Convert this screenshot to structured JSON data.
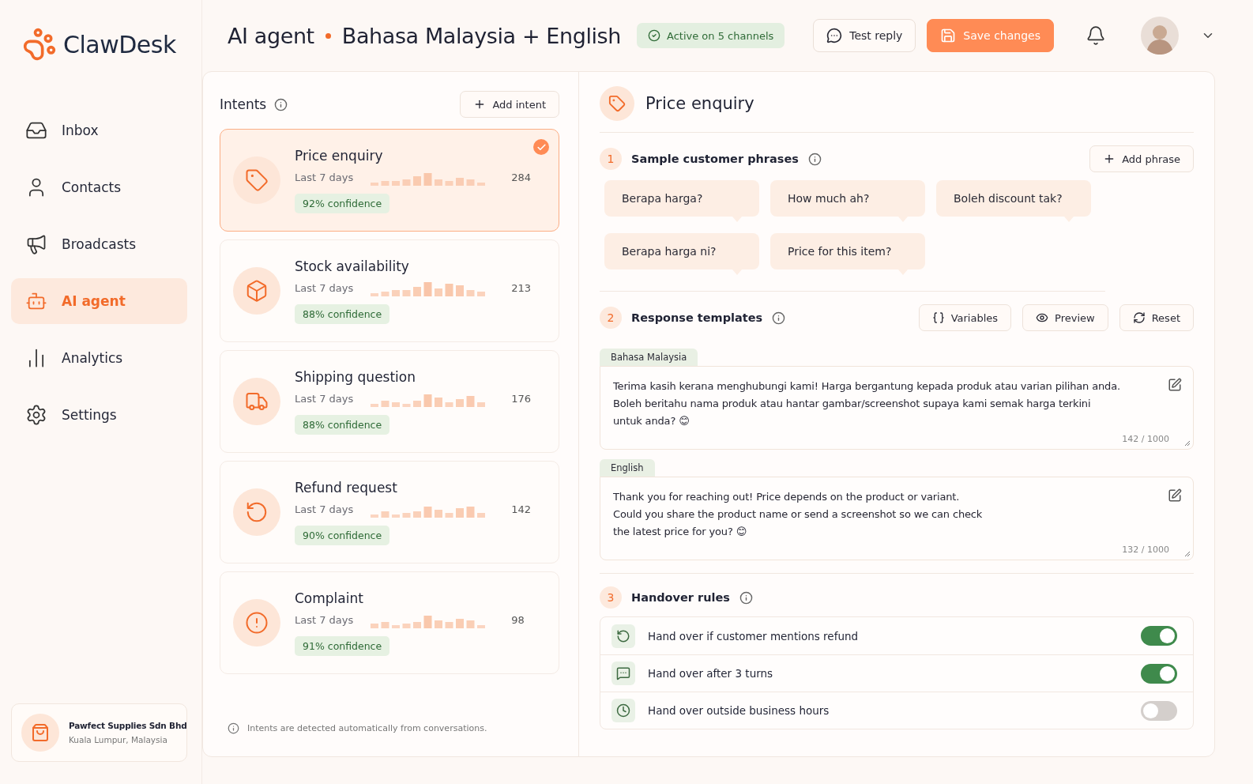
{
  "brand": {
    "name": "ClawDesk"
  },
  "nav": [
    {
      "label": "Inbox",
      "selected": false
    },
    {
      "label": "Contacts",
      "selected": false
    },
    {
      "label": "Broadcasts",
      "selected": false
    },
    {
      "label": "AI agent",
      "selected": true
    },
    {
      "label": "Analytics",
      "selected": false
    },
    {
      "label": "Settings",
      "selected": false
    }
  ],
  "workspace": {
    "name": "Pawfect Supplies Sdn Bhd",
    "location": "Kuala Lumpur, Malaysia"
  },
  "header": {
    "title": "AI agent",
    "subtitle": "Bahasa Malaysia + English",
    "status": "Active on 5 channels",
    "test_button": "Test reply",
    "save_button": "Save changes"
  },
  "intents": {
    "title": "Intents",
    "add_button": "Add intent",
    "footer": "Intents are detected automatically from conversations.",
    "items": [
      {
        "name": "Price enquiry",
        "period": "Last 7 days",
        "count": "284",
        "confidence": "92% confidence",
        "selected": true
      },
      {
        "name": "Stock availability",
        "period": "Last 7 days",
        "count": "213",
        "confidence": "88% confidence",
        "selected": false
      },
      {
        "name": "Shipping question",
        "period": "Last 7 days",
        "count": "176",
        "confidence": "88% confidence",
        "selected": false
      },
      {
        "name": "Refund request",
        "period": "Last 7 days",
        "count": "142",
        "confidence": "90% confidence",
        "selected": false
      },
      {
        "name": "Complaint",
        "period": "Last 7 days",
        "count": "98",
        "confidence": "91% confidence",
        "selected": false
      }
    ]
  },
  "detail": {
    "title": "Price enquiry",
    "phrases": {
      "step": "1",
      "title": "Sample customer phrases",
      "add_button": "Add phrase",
      "items": [
        "Berapa harga?",
        "How much ah?",
        "Boleh discount tak?",
        "Berapa harga ni?",
        "Price for this item?"
      ]
    },
    "templates": {
      "step": "2",
      "title": "Response templates",
      "buttons": [
        "Variables",
        "Preview",
        "Reset"
      ],
      "items": [
        {
          "language": "Bahasa Malaysia",
          "value": "Terima kasih kerana menghubungi kami! Harga bergantung kepada produk atau varian pilihan anda.\nBoleh beritahu nama produk atau hantar gambar/screenshot supaya kami semak harga terkini\nuntuk anda? 😊",
          "counter": "142 / 1000"
        },
        {
          "language": "English",
          "value": "Thank you for reaching out! Price depends on the product or variant.\nCould you share the product name or send a screenshot so we can check\nthe latest price for you? 😊",
          "counter": "132 / 1000"
        }
      ]
    },
    "handover": {
      "step": "3",
      "title": "Handover rules",
      "rules": [
        {
          "label": "Hand over if customer mentions refund",
          "on": true
        },
        {
          "label": "Hand over after 3 turns",
          "on": true
        },
        {
          "label": "Hand over outside business hours",
          "on": false
        }
      ]
    }
  }
}
